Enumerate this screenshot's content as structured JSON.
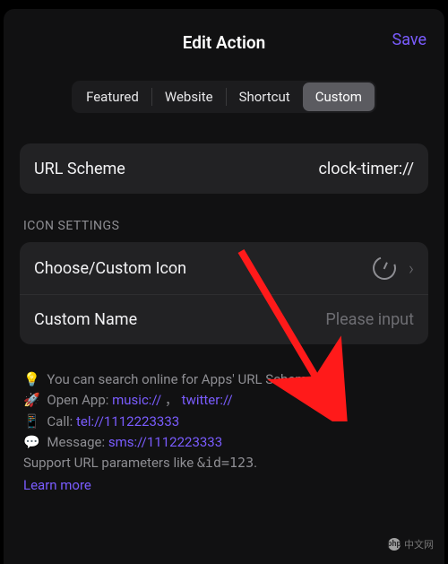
{
  "header": {
    "title": "Edit Action",
    "save": "Save"
  },
  "tabs": {
    "items": [
      "Featured",
      "Website",
      "Shortcut",
      "Custom"
    ],
    "selected": "Custom"
  },
  "url_row": {
    "label": "URL Scheme",
    "value": "clock-timer://"
  },
  "icon_section": {
    "header": "ICON SETTINGS",
    "choose_label": "Choose/Custom Icon",
    "name_label": "Custom Name",
    "name_placeholder": "Please input"
  },
  "tips": {
    "line1_text": "You can search online for Apps' URL Schemes.",
    "open_app_label": "Open App:",
    "open_app_link1": "music://",
    "open_app_link2": "twitter://",
    "call_label": "Call:",
    "call_link": "tel://1112223333",
    "message_label": "Message:",
    "message_link": "sms://1112223333",
    "support_text_pre": "Support URL parameters like ",
    "support_code": "&id=123",
    "learn_more": "Learn more"
  },
  "watermark": {
    "brand": "php",
    "text": "中文网"
  }
}
